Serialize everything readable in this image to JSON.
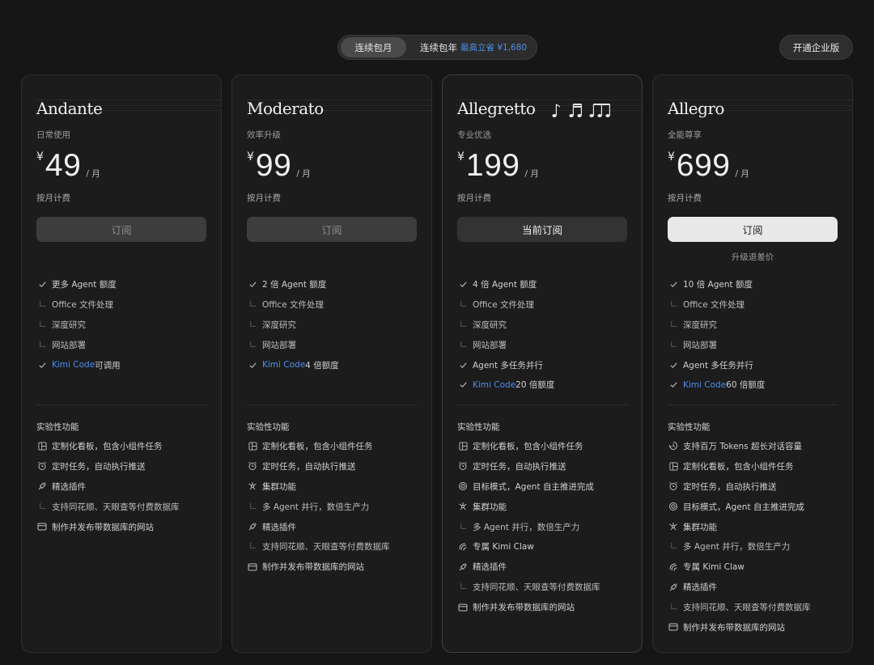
{
  "toggle": {
    "monthly": "连续包月",
    "yearly": "连续包年",
    "yearly_save": "最高立省 ¥1,680"
  },
  "enterprise_label": "开通企业版",
  "currency_symbol": "¥",
  "per_label": "/ 月",
  "colors": {
    "accent_blue": "#4d8ff0",
    "background": "#161616",
    "card": "#1c1c1c"
  },
  "plans": [
    {
      "name": "Andante",
      "sub": "日常使用",
      "price": "49",
      "billing": "按月计费",
      "button": "订阅",
      "features": [
        {
          "icon": "check",
          "pre": "更多 Agent 额度",
          "blue": "",
          "post": ""
        },
        {
          "icon": "sub",
          "pre": "Office 文件处理",
          "blue": "",
          "post": ""
        },
        {
          "icon": "sub",
          "pre": "深度研究",
          "blue": "",
          "post": ""
        },
        {
          "icon": "sub",
          "pre": "网站部署",
          "blue": "",
          "post": ""
        },
        {
          "icon": "check",
          "pre": "",
          "blue": "Kimi Code",
          "post": " 可调用"
        }
      ],
      "exp_label": "实验性功能",
      "experimental": [
        {
          "icon": "dashboard",
          "text": "定制化看板，包含小组件任务"
        },
        {
          "icon": "alarm",
          "text": "定时任务，自动执行推送"
        },
        {
          "icon": "plugin",
          "text": "精选插件"
        },
        {
          "icon": "sub",
          "text": "支持同花顺、天眼查等付费数据库"
        },
        {
          "icon": "database",
          "text": "制作并发布带数据库的网站"
        }
      ]
    },
    {
      "name": "Moderato",
      "sub": "效率升级",
      "price": "99",
      "billing": "按月计费",
      "button": "订阅",
      "features": [
        {
          "icon": "check",
          "pre": "2 倍 Agent 额度",
          "blue": "",
          "post": ""
        },
        {
          "icon": "sub",
          "pre": "Office 文件处理",
          "blue": "",
          "post": ""
        },
        {
          "icon": "sub",
          "pre": "深度研究",
          "blue": "",
          "post": ""
        },
        {
          "icon": "sub",
          "pre": "网站部署",
          "blue": "",
          "post": ""
        },
        {
          "icon": "check",
          "pre": "",
          "blue": "Kimi Code",
          "post": " 4 倍额度"
        }
      ],
      "exp_label": "实验性功能",
      "experimental": [
        {
          "icon": "dashboard",
          "text": "定制化看板，包含小组件任务"
        },
        {
          "icon": "alarm",
          "text": "定时任务，自动执行推送"
        },
        {
          "icon": "cluster",
          "text": "集群功能"
        },
        {
          "icon": "sub",
          "text": "多 Agent 并行，数倍生产力"
        },
        {
          "icon": "plugin",
          "text": "精选插件"
        },
        {
          "icon": "sub",
          "text": "支持同花顺、天眼查等付费数据库"
        },
        {
          "icon": "database",
          "text": "制作并发布带数据库的网站"
        }
      ]
    },
    {
      "name": "Allegretto",
      "sub": "专业优选",
      "price": "199",
      "billing": "按月计费",
      "button": "当前订阅",
      "features": [
        {
          "icon": "check",
          "pre": "4 倍 Agent 额度",
          "blue": "",
          "post": ""
        },
        {
          "icon": "sub",
          "pre": "Office 文件处理",
          "blue": "",
          "post": ""
        },
        {
          "icon": "sub",
          "pre": "深度研究",
          "blue": "",
          "post": ""
        },
        {
          "icon": "sub",
          "pre": "网站部署",
          "blue": "",
          "post": ""
        },
        {
          "icon": "check",
          "pre": "Agent 多任务并行",
          "blue": "",
          "post": ""
        },
        {
          "icon": "check",
          "pre": "",
          "blue": "Kimi Code",
          "post": " 20 倍额度"
        }
      ],
      "exp_label": "实验性功能",
      "experimental": [
        {
          "icon": "dashboard",
          "text": "定制化看板，包含小组件任务"
        },
        {
          "icon": "alarm",
          "text": "定时任务，自动执行推送"
        },
        {
          "icon": "target",
          "text": "目标模式，Agent 自主推进完成"
        },
        {
          "icon": "cluster",
          "text": "集群功能"
        },
        {
          "icon": "sub",
          "text": "多 Agent 并行，数倍生产力"
        },
        {
          "icon": "claw",
          "text": "专属 Kimi Claw"
        },
        {
          "icon": "plugin",
          "text": "精选插件"
        },
        {
          "icon": "sub",
          "text": "支持同花顺、天眼查等付费数据库"
        },
        {
          "icon": "database",
          "text": "制作并发布带数据库的网站"
        }
      ]
    },
    {
      "name": "Allegro",
      "sub": "全能尊享",
      "price": "699",
      "billing": "按月计费",
      "button": "订阅",
      "upgrade_note": "升级退差价",
      "features": [
        {
          "icon": "check",
          "pre": "10 倍 Agent 额度",
          "blue": "",
          "post": ""
        },
        {
          "icon": "sub",
          "pre": "Office 文件处理",
          "blue": "",
          "post": ""
        },
        {
          "icon": "sub",
          "pre": "深度研究",
          "blue": "",
          "post": ""
        },
        {
          "icon": "sub",
          "pre": "网站部署",
          "blue": "",
          "post": ""
        },
        {
          "icon": "check",
          "pre": "Agent 多任务并行",
          "blue": "",
          "post": ""
        },
        {
          "icon": "check",
          "pre": "",
          "blue": "Kimi Code",
          "post": " 60 倍额度"
        }
      ],
      "exp_label": "实验性功能",
      "experimental": [
        {
          "icon": "context",
          "text": "支持百万 Tokens 超长对话容量"
        },
        {
          "icon": "dashboard",
          "text": "定制化看板，包含小组件任务"
        },
        {
          "icon": "alarm",
          "text": "定时任务，自动执行推送"
        },
        {
          "icon": "target",
          "text": "目标模式，Agent 自主推进完成"
        },
        {
          "icon": "cluster",
          "text": "集群功能"
        },
        {
          "icon": "sub",
          "text": "多 Agent 并行，数倍生产力"
        },
        {
          "icon": "claw",
          "text": "专属 Kimi Claw"
        },
        {
          "icon": "plugin",
          "text": "精选插件"
        },
        {
          "icon": "sub",
          "text": "支持同花顺、天眼查等付费数据库"
        },
        {
          "icon": "database",
          "text": "制作并发布带数据库的网站"
        }
      ]
    }
  ]
}
